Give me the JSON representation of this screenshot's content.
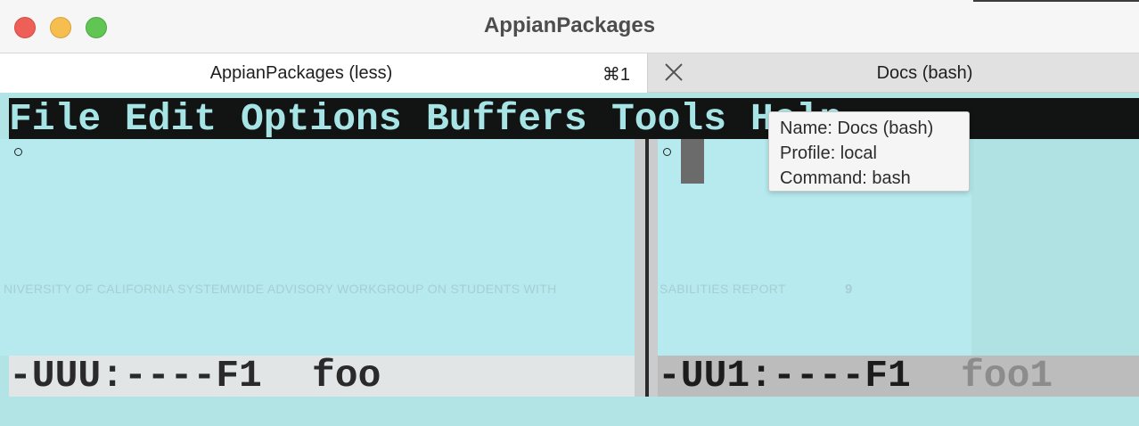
{
  "window": {
    "title": "AppianPackages"
  },
  "tabs": [
    {
      "label": "AppianPackages (less)",
      "shortcut": "⌘1",
      "active": true
    },
    {
      "label": "Docs (bash)",
      "active": false
    }
  ],
  "menubar": {
    "items": [
      "File",
      "Edit",
      "Options",
      "Buffers",
      "Tools",
      "Help"
    ]
  },
  "watermark": {
    "left_text": "NIVERSITY OF CALIFORNIA SYSTEMWIDE ADVISORY WORKGROUP ON STUDENTS WITH",
    "right_text": "SABILITIES REPORT",
    "page_number": "9"
  },
  "modeline": {
    "left_status": "-UUU:----F1",
    "left_buffer": "foo",
    "right_status": "-UU1:----F1",
    "right_buffer": "foo1"
  },
  "tooltip": {
    "name": "Name: Docs (bash)",
    "profile": "Profile: local",
    "command": "Command: bash"
  },
  "colors": {
    "terminal_bg": "#b2e4e6",
    "menubar_bg": "#121414",
    "menubar_text": "#a6e4e6",
    "modeline_inactive_text": "#8c8c8c"
  }
}
